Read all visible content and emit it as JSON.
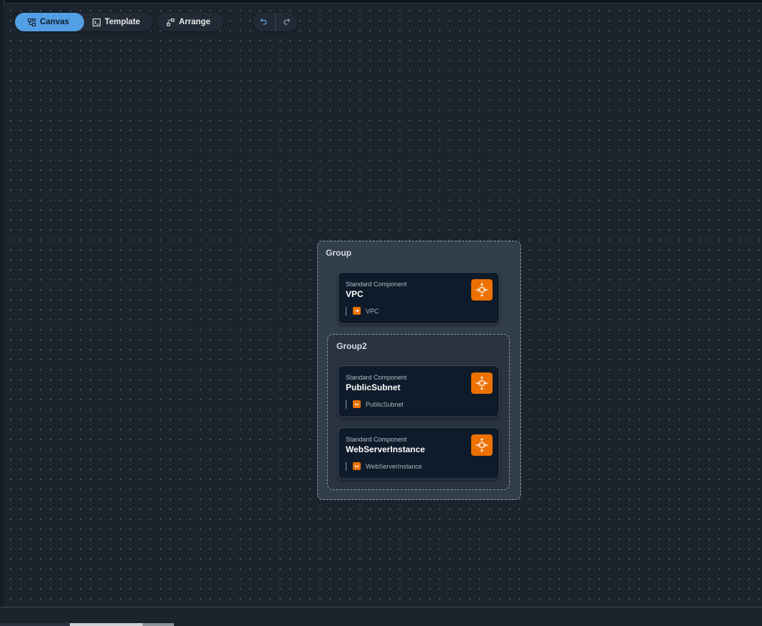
{
  "toolbar": {
    "canvas_label": "Canvas",
    "template_label": "Template",
    "arrange_label": "Arrange"
  },
  "colors": {
    "accent": "#539fe5",
    "component_orange": "#ed7100",
    "canvas_bg": "#1b232d"
  },
  "diagram": {
    "group_outer": {
      "title": "Group"
    },
    "group_inner": {
      "title": "Group2"
    },
    "components": [
      {
        "kind": "Standard Component",
        "name": "VPC",
        "resource": "VPC",
        "icon": "ec2-component-icon"
      },
      {
        "kind": "Standard Component",
        "name": "PublicSubnet",
        "resource": "PublicSubnet",
        "icon": "ec2-component-icon"
      },
      {
        "kind": "Standard Component",
        "name": "WebServerInstance",
        "resource": "WebServerInstance",
        "icon": "ec2-component-icon"
      }
    ]
  }
}
